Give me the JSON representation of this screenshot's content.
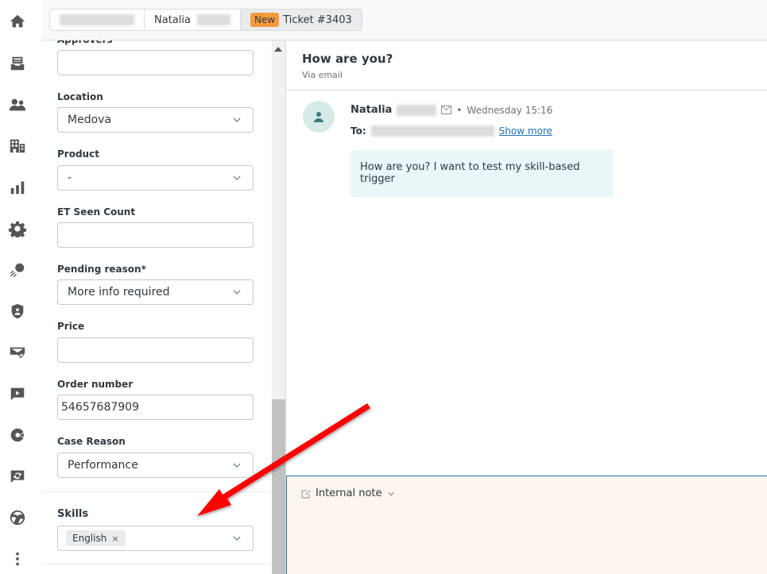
{
  "nav": {
    "items": [
      {
        "name": "home-icon"
      },
      {
        "name": "views-icon"
      },
      {
        "name": "customers-icon"
      },
      {
        "name": "organizations-icon"
      },
      {
        "name": "reporting-icon"
      },
      {
        "name": "admin-settings-icon"
      },
      {
        "name": "apps-icon"
      },
      {
        "name": "security-icon"
      },
      {
        "name": "email-icon"
      },
      {
        "name": "video-chat-icon"
      },
      {
        "name": "sell-icon"
      },
      {
        "name": "talk-icon"
      },
      {
        "name": "explore-icon"
      },
      {
        "name": "more-icon"
      }
    ]
  },
  "tabs": {
    "user_name": "Natalia",
    "ticket_badge": "New",
    "ticket_label": "Ticket #3403"
  },
  "form": {
    "approvers_label": "Approvers",
    "approvers_value": "",
    "location_label": "Location",
    "location_value": "Medova",
    "product_label": "Product",
    "product_value": "-",
    "et_seen_label": "ET Seen Count",
    "et_seen_value": "",
    "pending_label": "Pending reason*",
    "pending_value": "More info required",
    "price_label": "Price",
    "price_value": "",
    "order_label": "Order number",
    "order_value": "54657687909",
    "case_reason_label": "Case Reason",
    "case_reason_value": "Performance",
    "skills_label": "Skills",
    "skills_tag": "English",
    "skills_tag_remove": "×"
  },
  "conversation": {
    "title": "How are you?",
    "channel": "Via email",
    "sender": "Natalia",
    "separator": "•",
    "timestamp": "Wednesday 15:16",
    "to_label": "To:",
    "show_more": "Show more",
    "message": "How are you? I want to test my skill-based trigger"
  },
  "composer": {
    "mode": "Internal note"
  },
  "colors": {
    "badge_new": "#f79a3e",
    "link": "#1f73b7",
    "bubble": "#e9f7f8",
    "composer_bg": "#fdf5ee",
    "annotation_arrow": "#ff0000"
  }
}
